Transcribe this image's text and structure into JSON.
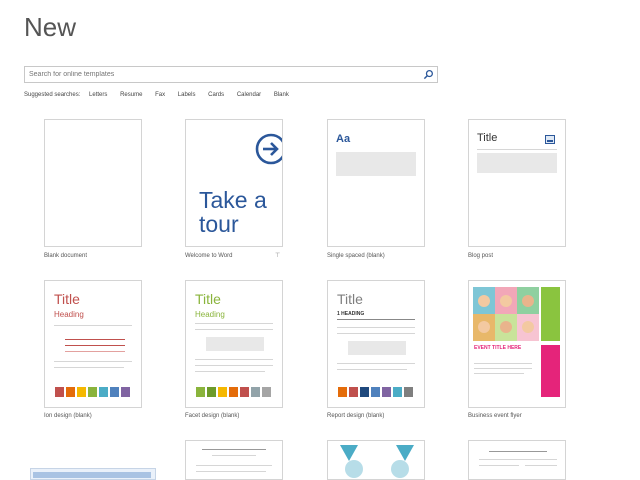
{
  "page": {
    "title": "New"
  },
  "search": {
    "placeholder": "Search for online templates"
  },
  "suggested": {
    "label": "Suggested searches:",
    "items": [
      "Letters",
      "Resume",
      "Fax",
      "Labels",
      "Cards",
      "Calendar",
      "Blank"
    ]
  },
  "templates": [
    {
      "caption": "Blank document"
    },
    {
      "caption": "Welcome to Word",
      "tour_line1": "Take a",
      "tour_line2": "tour",
      "pin": "⊤"
    },
    {
      "caption": "Single spaced (blank)",
      "heading": "Aa"
    },
    {
      "caption": "Blog post",
      "heading": "Title"
    },
    {
      "caption": "Ion design (blank)",
      "heading": "Title",
      "subheading": "Heading"
    },
    {
      "caption": "Facet design (blank)",
      "heading": "Title",
      "subheading": "Heading"
    },
    {
      "caption": "Report design (blank)",
      "heading": "Title",
      "subheading": "1   HEADING"
    },
    {
      "caption": "Business event flyer",
      "headline": "EVENT TITLE HERE"
    }
  ],
  "colors": {
    "accent_blue": "#2b579a",
    "ion_title": "#c0504d",
    "facet_title": "#8ab43c",
    "report_title": "#7f7f7f"
  },
  "swatches": {
    "ion": [
      "#c0504d",
      "#e46c0a",
      "#f5b800",
      "#8ab43c",
      "#4bacc6",
      "#4f81bd",
      "#8064a2"
    ],
    "facet": [
      "#8ab43c",
      "#6d9b2a",
      "#f5b800",
      "#e46c0a",
      "#c0504d",
      "#92a3a9",
      "#a5a5a5"
    ],
    "report": [
      "#e46c0a",
      "#c0504d",
      "#1f497d",
      "#4f81bd",
      "#8064a2",
      "#4bacc6",
      "#7f7f7f"
    ]
  }
}
